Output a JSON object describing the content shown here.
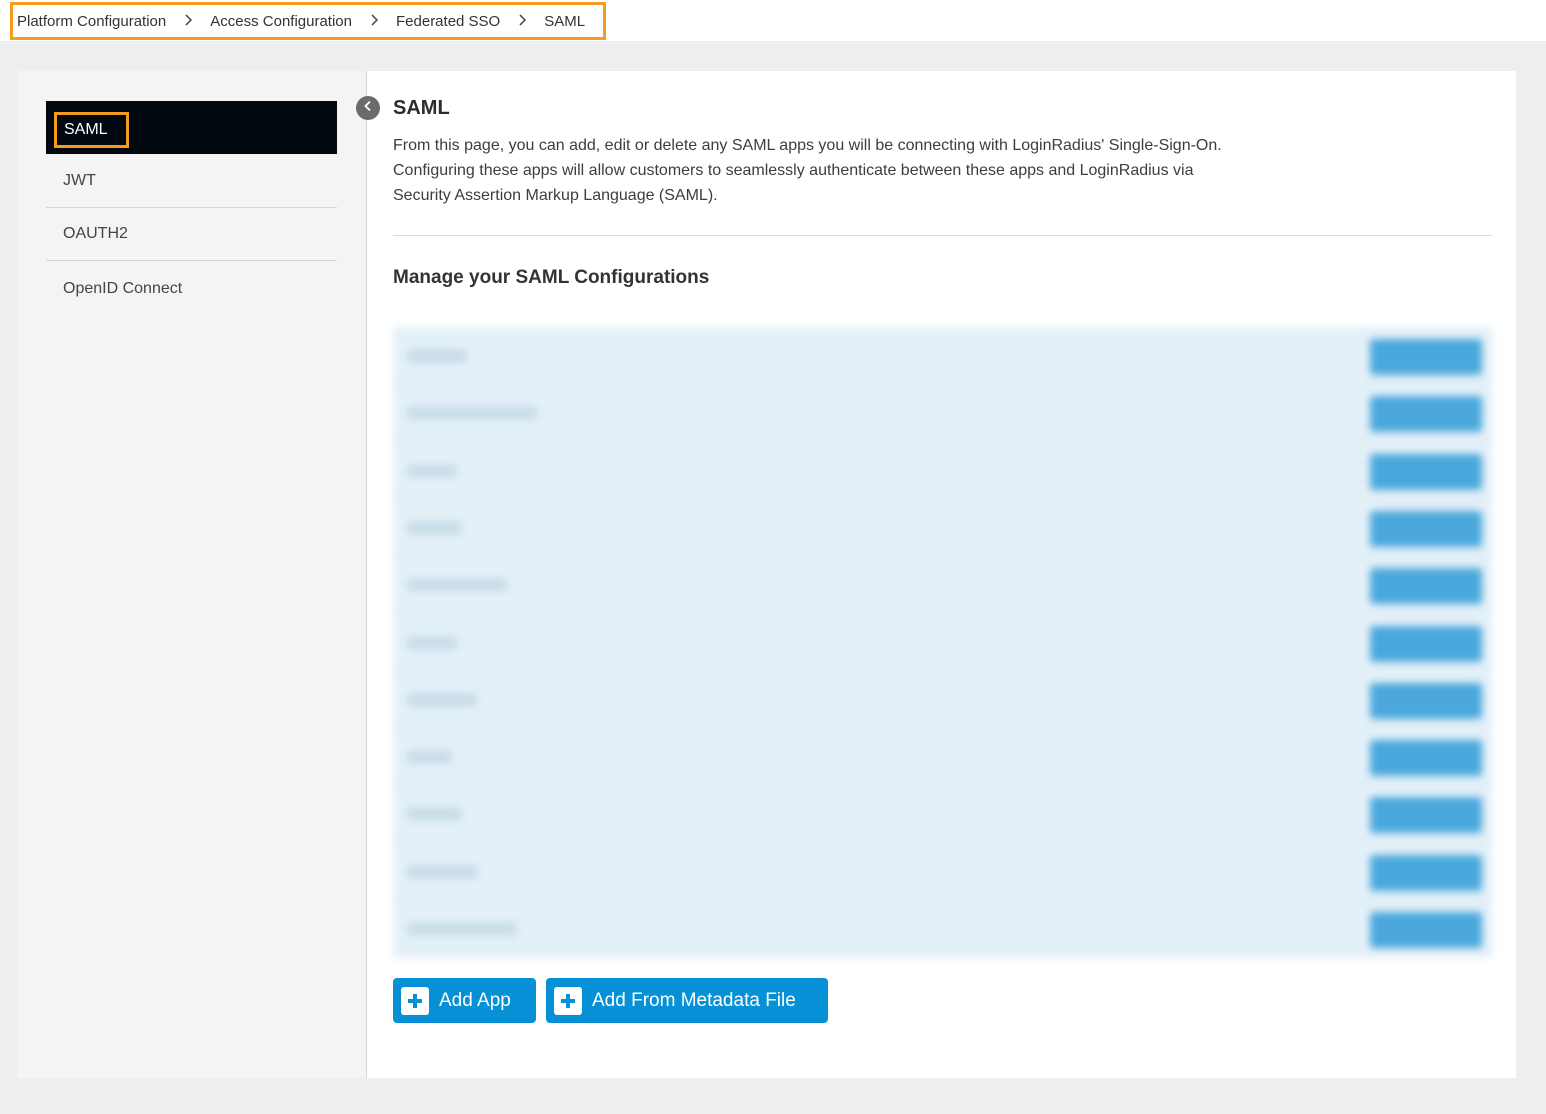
{
  "breadcrumb": {
    "items": [
      "Platform Configuration",
      "Access Configuration",
      "Federated SSO",
      "SAML"
    ],
    "separator_icon": "chevron-right-icon"
  },
  "sidebar": {
    "items": [
      {
        "label": "SAML",
        "active": true
      },
      {
        "label": "JWT",
        "active": false
      },
      {
        "label": "OAUTH2",
        "active": false
      },
      {
        "label": "OpenID Connect",
        "active": false
      }
    ],
    "collapse_icon": "chevron-left-icon"
  },
  "main": {
    "title": "SAML",
    "description_lines": [
      "From this page, you can add, edit or delete any SAML apps you will be connecting with LoginRadius' Single-Sign-On.",
      "Configuring these apps will allow customers to seamlessly authenticate between these apps and LoginRadius via",
      "Security Assertion Markup Language (SAML)."
    ],
    "section_title": "Manage your SAML Configurations",
    "configurations_blurred": true,
    "buttons": {
      "add_app": "Add App",
      "add_from_metadata": "Add From Metadata File",
      "icon": "plus-icon"
    }
  },
  "colors": {
    "accent": "#0691d6",
    "highlight": "#f39c1f",
    "active_nav_bg": "#02080f"
  }
}
